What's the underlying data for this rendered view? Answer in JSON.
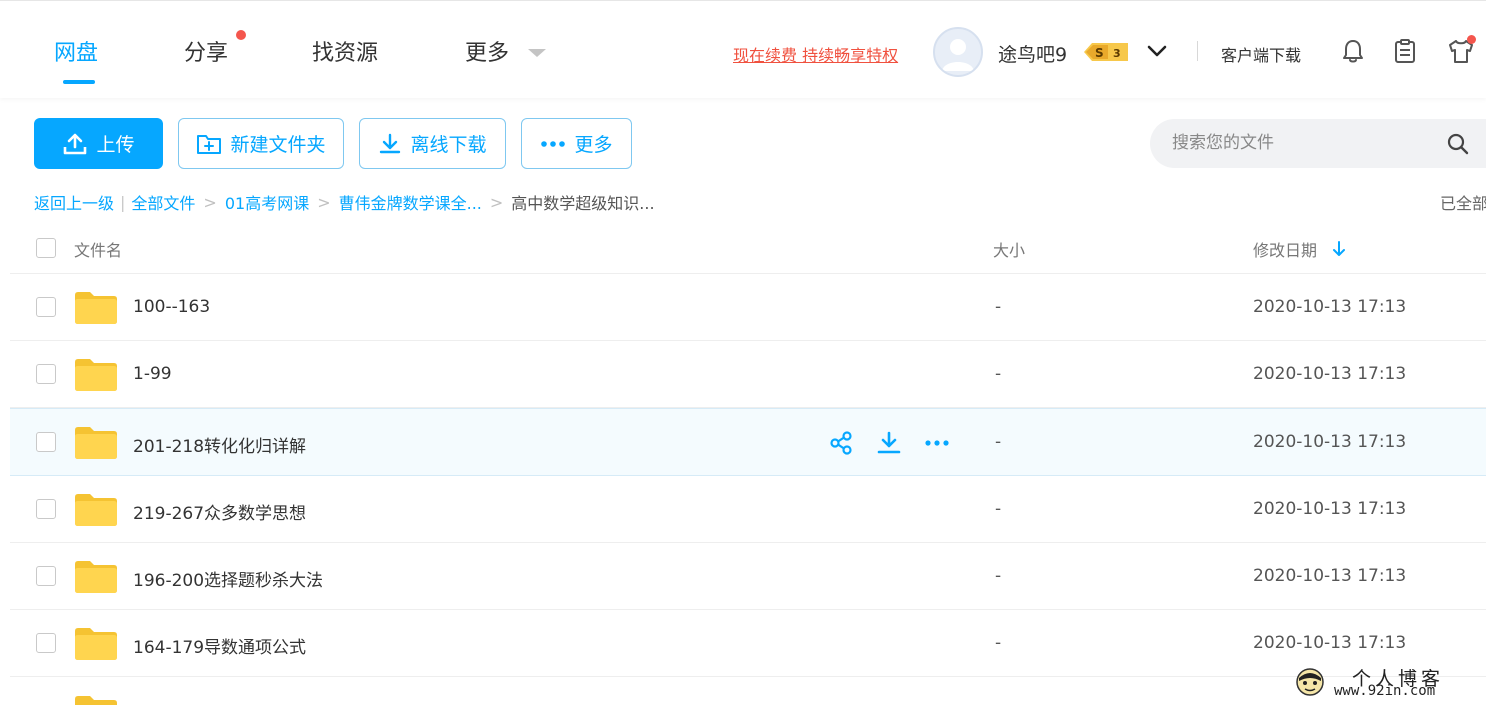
{
  "header": {
    "tabs": [
      {
        "label": "网盘",
        "active": true
      },
      {
        "label": "分享",
        "has_dot": true
      },
      {
        "label": "找资源"
      },
      {
        "label": "更多",
        "has_dropdown": true
      }
    ],
    "renew_text": "现在续费 持续畅享特权",
    "username": "途鸟吧9",
    "vip_badge": {
      "letter": "S",
      "level": "3"
    },
    "client_download": "客户端下载",
    "icons": [
      "bell-icon",
      "clipboard-icon",
      "tshirt-icon"
    ]
  },
  "toolbar": {
    "upload_label": "上传",
    "new_folder_label": "新建文件夹",
    "offline_download_label": "离线下载",
    "more_label": "更多"
  },
  "search": {
    "placeholder": "搜索您的文件"
  },
  "breadcrumb": {
    "back": "返回上一级",
    "items": [
      "全部文件",
      "01高考网课",
      "曹伟金牌数学课全...",
      "高中数学超级知识..."
    ],
    "loaded_status": "已全部"
  },
  "file_list": {
    "columns": {
      "name": "文件名",
      "size": "大小",
      "modified": "修改日期"
    },
    "rows": [
      {
        "name": "100--163",
        "size": "-",
        "modified": "2020-10-13 17:13"
      },
      {
        "name": "1-99",
        "size": "-",
        "modified": "2020-10-13 17:13"
      },
      {
        "name": "201-218转化化归详解",
        "size": "-",
        "modified": "2020-10-13 17:13",
        "hovered": true
      },
      {
        "name": "219-267众多数学思想",
        "size": "-",
        "modified": "2020-10-13 17:13"
      },
      {
        "name": "196-200选择题秒杀大法",
        "size": "-",
        "modified": "2020-10-13 17:13"
      },
      {
        "name": "164-179导数通项公式",
        "size": "-",
        "modified": "2020-10-13 17:13"
      }
    ]
  },
  "watermark": {
    "title": "个人博客",
    "url": "www.92in.com"
  },
  "colors": {
    "accent": "#06a7ff",
    "renew": "#f0513f",
    "folder": "#ffd24c",
    "hover_row": "#f4fbfe"
  }
}
